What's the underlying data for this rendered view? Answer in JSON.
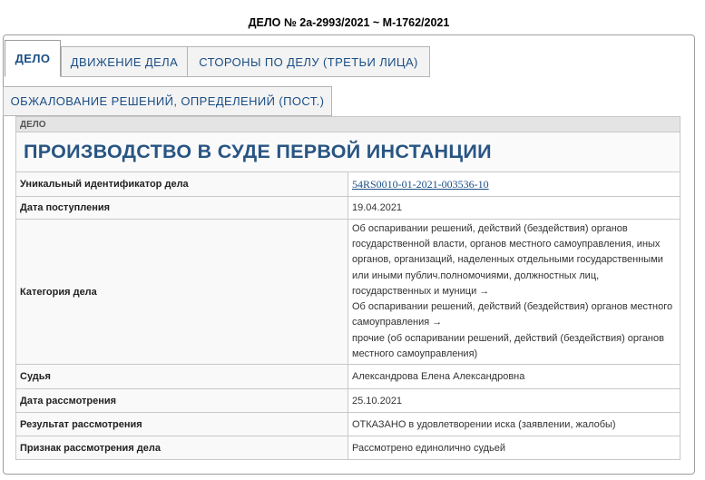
{
  "case": {
    "title": "ДЕЛО № 2а-2993/2021 ~ М-1762/2021"
  },
  "tabs": [
    {
      "label": "ДЕЛО",
      "active": true
    },
    {
      "label": "ДВИЖЕНИЕ ДЕЛА",
      "active": false
    },
    {
      "label": "СТОРОНЫ ПО ДЕЛУ (ТРЕТЬИ ЛИЦА)",
      "active": false
    },
    {
      "label": "ОБЖАЛОВАНИЕ РЕШЕНИЙ, ОПРЕДЕЛЕНИЙ (ПОСТ.)",
      "active": false
    }
  ],
  "section": {
    "header": "ДЕЛО",
    "title": "ПРОИЗВОДСТВО В СУДЕ ПЕРВОЙ ИНСТАНЦИИ"
  },
  "rows": {
    "uid": {
      "label": "Уникальный идентификатор дела",
      "value": "54RS0010-01-2021-003536-10"
    },
    "received": {
      "label": "Дата поступления",
      "value": "19.04.2021"
    },
    "category": {
      "label": "Категория дела",
      "lines": [
        "Об оспаривании решений, действий (бездействия) органов",
        "государственной власти, органов местного самоуправления, иных",
        "органов, организаций, наделенных отдельными государственными",
        "или иными публич.полномочиями, должностных лиц,",
        "государственных и муници →",
        "Об оспаривании решений, действий (бездействия) органов местного",
        "самоуправления →",
        "прочие (об оспаривании решений, действий (бездействия) органов",
        "местного самоуправления)"
      ]
    },
    "judge": {
      "label": "Судья",
      "value": "Александрова Елена Александровна"
    },
    "review_date": {
      "label": "Дата рассмотрения",
      "value": "25.10.2021"
    },
    "result": {
      "label": "Результат рассмотрения",
      "value": "ОТКАЗАНО в удовлетворении иска (заявлении, жалобы)"
    },
    "mode": {
      "label": "Признак рассмотрения дела",
      "value": "Рассмотрено единолично судьей"
    }
  },
  "colors": {
    "accent": "#1a4e86",
    "title": "#285583",
    "section_bg": "#e4e4e4"
  }
}
